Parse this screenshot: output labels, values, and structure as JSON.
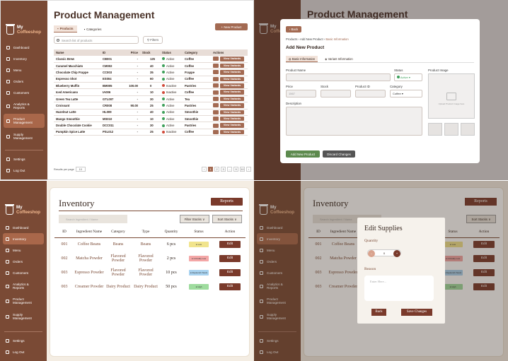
{
  "brand": {
    "line1": "My",
    "line2a": "Coffee",
    "line2b": "shop"
  },
  "nav": {
    "dashboard": "Dashboard",
    "inventory": "Inventory",
    "menu": "Menu",
    "orders": "Orders",
    "customers": "Customers",
    "analytics": "Analytics & Reports",
    "product_mgmt": "Product Management",
    "supply_mgmt": "Supply Management",
    "settings": "Settings",
    "logout": "Log Out"
  },
  "products": {
    "title": "Product Management",
    "new_button": "New Product",
    "tab_products": "Products",
    "tab_categories": "Categories",
    "search_placeholder": "Search list of products",
    "filters": "Filters",
    "headers": [
      "Name",
      "ID",
      "Price",
      "Stock",
      "Status",
      "Category",
      "Actions"
    ],
    "view_variants": "View Variants",
    "rows": [
      {
        "name": "Classic Brew",
        "id": "CB001",
        "price": "-",
        "stock": "125",
        "status": "Active",
        "category": "Coffee"
      },
      {
        "name": "Caramel Macchiato",
        "id": "CM002",
        "price": "-",
        "stock": "40",
        "status": "Active",
        "category": "Coffee"
      },
      {
        "name": "Chocolate Chip Frappe",
        "id": "CC003",
        "price": "-",
        "stock": "35",
        "status": "Active",
        "category": "Frappe"
      },
      {
        "name": "Espresso Shot",
        "id": "ES004",
        "price": "-",
        "stock": "60",
        "status": "Active",
        "category": "Coffee"
      },
      {
        "name": "Blueberry Muffin",
        "id": "BM005",
        "price": "100.00",
        "stock": "0",
        "status": "Inactive",
        "category": "Pastries"
      },
      {
        "name": "Iced Americano",
        "id": "IA006",
        "price": "-",
        "stock": "10",
        "status": "Inactive",
        "category": "Coffee"
      },
      {
        "name": "Green Tea Latte",
        "id": "GTL007",
        "price": "-",
        "stock": "30",
        "status": "Active",
        "category": "Tea"
      },
      {
        "name": "Croissant",
        "id": "CR008",
        "price": "90.00",
        "stock": "25",
        "status": "Active",
        "category": "Pastries"
      },
      {
        "name": "Hazelnut Latte",
        "id": "HL009",
        "price": "-",
        "stock": "40",
        "status": "Active",
        "category": "Smoothie"
      },
      {
        "name": "Mango Smoothie",
        "id": "MS010",
        "price": "-",
        "stock": "10",
        "status": "Active",
        "category": "Smoothie"
      },
      {
        "name": "Double Chocolate Cookie",
        "id": "DCC011",
        "price": "-",
        "stock": "30",
        "status": "Active",
        "category": "Pastries"
      },
      {
        "name": "Pumpkin Spice Latte",
        "id": "PSL012",
        "price": "-",
        "stock": "25",
        "status": "Inactive",
        "category": "Coffee"
      }
    ],
    "results_label": "Results per page",
    "results_value": "10",
    "pages": [
      "1",
      "2",
      "3",
      "...",
      "9",
      "10"
    ]
  },
  "add_product": {
    "back": "Back",
    "breadcrumb": [
      "Products",
      "Add New Product",
      "Basic Information"
    ],
    "title": "Add New Product",
    "tab_basic": "Basic Information",
    "tab_variant": "Variant Information",
    "product_name": "Product Name",
    "status": "Status",
    "status_value": "Active",
    "product_image": "Product Image",
    "price": "Price",
    "price_value": "1567",
    "stock": "Stock",
    "product_id": "Product ID",
    "category": "Category",
    "category_value": "Coffee",
    "description": "Description",
    "image_hint": "Upload Product Image here",
    "add_button": "Add New Product",
    "discard_button": "Discard Changes"
  },
  "inventory": {
    "title": "Inventory",
    "reports": "Reports",
    "search_placeholder": "Search Ingredient / Name",
    "filter_stocks": "Filter Stocks",
    "sort_stocks": "Sort Stocks",
    "headers": [
      "ID",
      "Ingredient Name",
      "Category",
      "Type",
      "Quantity",
      "Status",
      "Action"
    ],
    "edit": "Edit",
    "rows": [
      {
        "id": "001",
        "name": "Coffee Beans",
        "category": "Beans",
        "type": "Beans",
        "qty": "6 pcs",
        "status": "Low"
      },
      {
        "id": "002",
        "name": "Matcha Powder",
        "category": "Flavored Powder",
        "type": "Flavored Powder",
        "qty": "2 pcs",
        "status": "Critically Low"
      },
      {
        "id": "003",
        "name": "Espresso Powder",
        "category": "Flavored Powder",
        "type": "Flavored Powder",
        "qty": "10 pcs",
        "status": "Replenish Stock"
      },
      {
        "id": "003",
        "name": "Creamer Powder",
        "category": "Dairy Product",
        "type": "Dairy Product",
        "qty": "50 pcs",
        "status": "High"
      }
    ],
    "status_colors": {
      "Low": "#f1e48d",
      "Critically Low": "#f4a7a7",
      "Replenish Stock": "#a9d3f0",
      "High": "#9edc9e"
    }
  },
  "edit_supplies": {
    "title": "Edit Supplies",
    "quantity": "Quantity",
    "qty_value": "0",
    "reason": "Reason",
    "reason_placeholder": "Enter Here...",
    "back": "Back",
    "save": "Save Changes"
  }
}
